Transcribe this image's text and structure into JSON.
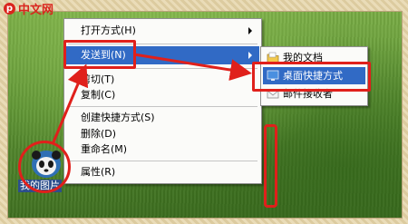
{
  "watermark": {
    "badge": "p",
    "text": "中文网"
  },
  "context_menu": {
    "items": [
      {
        "label": "打开方式(H)",
        "has_submenu": true
      },
      {
        "label": "发送到(N)",
        "has_submenu": true,
        "highlighted": true
      },
      {
        "label": "剪切(T)"
      },
      {
        "label": "复制(C)"
      },
      {
        "label": "创建快捷方式(S)"
      },
      {
        "label": "删除(D)"
      },
      {
        "label": "重命名(M)"
      },
      {
        "label": "属性(R)"
      }
    ]
  },
  "send_to_submenu": {
    "items": [
      {
        "label": "我的文档",
        "icon": "folder-icon"
      },
      {
        "label": "桌面快捷方式",
        "icon": "desktop-icon",
        "highlighted": true
      },
      {
        "label": "邮件接收者",
        "icon": "mail-icon"
      }
    ]
  },
  "desktop_icon": {
    "label": "我的图片",
    "icon": "panda-icon"
  },
  "colors": {
    "highlight": "#316ac5",
    "annotation": "#e0201b"
  }
}
